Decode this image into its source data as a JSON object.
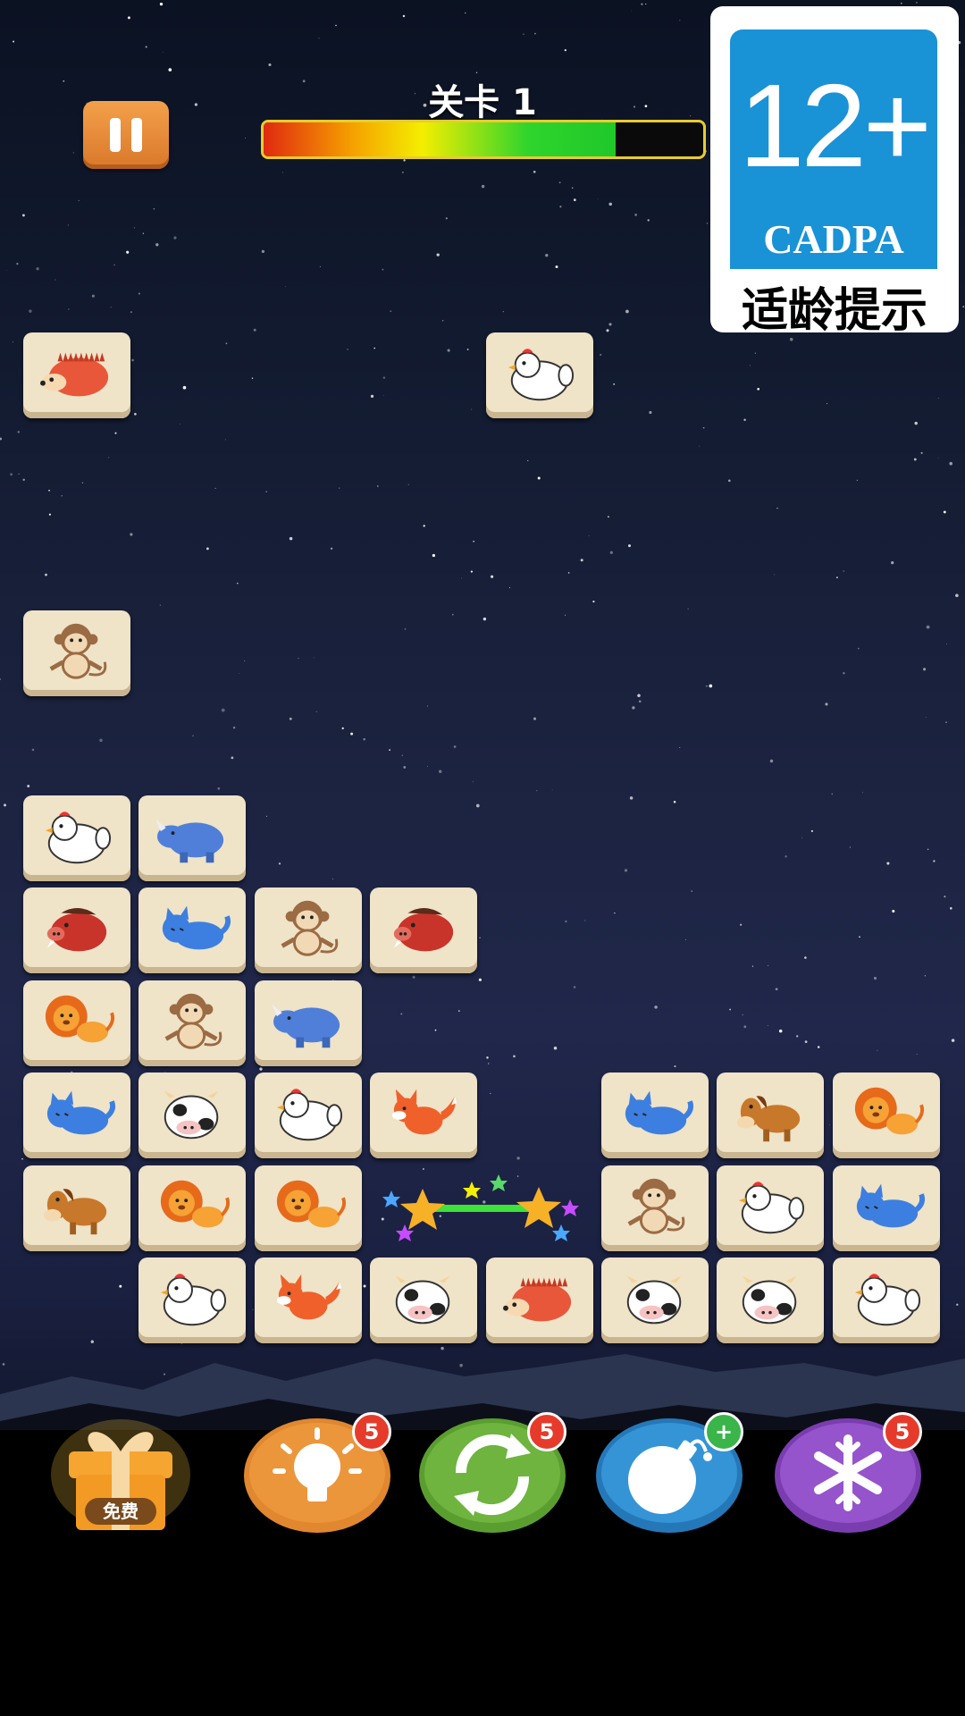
{
  "level": {
    "title": "关卡 1",
    "progress": 0.8
  },
  "rating": {
    "age": "12+",
    "org": "CADPA",
    "label": "适龄提示"
  },
  "colors": {
    "pause": "#e88a33",
    "tile": "#efe3c8",
    "hint": "#e0872f",
    "shuffle": "#65ab3a",
    "bomb": "#2f8fd0",
    "freeze": "#8a4bbf"
  },
  "tiles": [
    {
      "animal": "hedgehog",
      "col": 0,
      "row": 0
    },
    {
      "animal": "chicken",
      "col": 4,
      "row": 0
    },
    {
      "animal": "monkey",
      "col": 0,
      "row": 3
    },
    {
      "animal": "chicken",
      "col": 0,
      "row": 5
    },
    {
      "animal": "rhino",
      "col": 1,
      "row": 5
    },
    {
      "animal": "boar",
      "col": 0,
      "row": 6
    },
    {
      "animal": "cat",
      "col": 1,
      "row": 6
    },
    {
      "animal": "monkey",
      "col": 2,
      "row": 6
    },
    {
      "animal": "boar",
      "col": 3,
      "row": 6
    },
    {
      "animal": "lion",
      "col": 0,
      "row": 7
    },
    {
      "animal": "monkey",
      "col": 1,
      "row": 7
    },
    {
      "animal": "rhino",
      "col": 2,
      "row": 7
    },
    {
      "animal": "cat",
      "col": 0,
      "row": 8
    },
    {
      "animal": "cow",
      "col": 1,
      "row": 8
    },
    {
      "animal": "chicken",
      "col": 2,
      "row": 8
    },
    {
      "animal": "fox",
      "col": 3,
      "row": 8
    },
    {
      "animal": "cat",
      "col": 5,
      "row": 8
    },
    {
      "animal": "horse",
      "col": 6,
      "row": 8
    },
    {
      "animal": "lion",
      "col": 7,
      "row": 8
    },
    {
      "animal": "horse",
      "col": 0,
      "row": 9
    },
    {
      "animal": "lion",
      "col": 1,
      "row": 9
    },
    {
      "animal": "lion",
      "col": 2,
      "row": 9
    },
    {
      "animal": "monkey",
      "col": 5,
      "row": 9
    },
    {
      "animal": "chicken",
      "col": 6,
      "row": 9
    },
    {
      "animal": "cat",
      "col": 7,
      "row": 9
    },
    {
      "animal": "chicken",
      "col": 1,
      "row": 10
    },
    {
      "animal": "fox",
      "col": 2,
      "row": 10
    },
    {
      "animal": "cow",
      "col": 3,
      "row": 10
    },
    {
      "animal": "hedgehog",
      "col": 4,
      "row": 10
    },
    {
      "animal": "cow",
      "col": 5,
      "row": 10
    },
    {
      "animal": "cow",
      "col": 6,
      "row": 10
    },
    {
      "animal": "chicken",
      "col": 7,
      "row": 10
    }
  ],
  "powerups": {
    "gift": {
      "icon": "gift-box-icon",
      "label": "免费"
    },
    "hint": {
      "icon": "lightbulb-icon",
      "count": "5"
    },
    "shuffle": {
      "icon": "refresh-icon",
      "count": "5"
    },
    "bomb": {
      "icon": "bomb-icon",
      "count": "+"
    },
    "freeze": {
      "icon": "snowflake-icon",
      "count": "5"
    }
  }
}
